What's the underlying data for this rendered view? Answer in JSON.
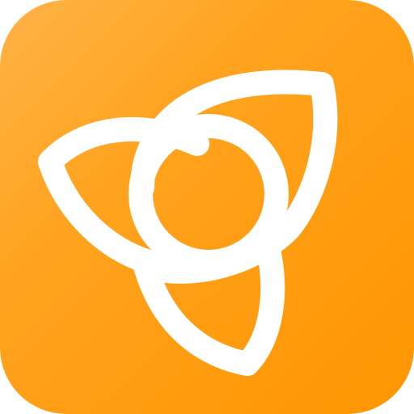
{
  "icon": {
    "name": "triquetra-logo-icon",
    "colors": {
      "background_light": "#FFB347",
      "background_mid": "#FFA31F",
      "background_dark": "#FF9500",
      "knot_stroke": "#FFFFFF"
    }
  }
}
